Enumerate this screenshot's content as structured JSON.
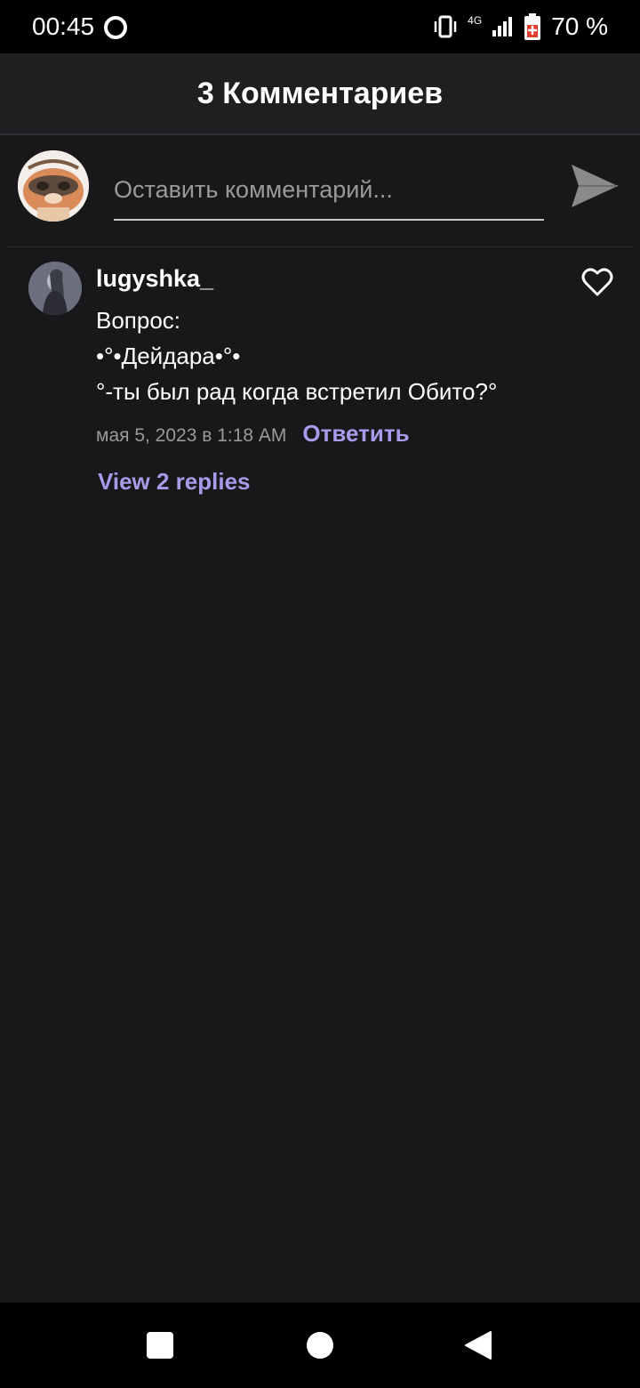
{
  "status_bar": {
    "time": "00:45",
    "battery_percent": "70 %",
    "network": "4G",
    "icons": [
      "opera-icon",
      "vibrate-icon",
      "signal-icon",
      "battery-icon"
    ]
  },
  "header": {
    "title": "3 Комментариев"
  },
  "composer": {
    "placeholder": "Оставить комментарий...",
    "value": "",
    "send_icon": "send-icon"
  },
  "comments": [
    {
      "username": "lugyshka_",
      "lines": [
        "Вопрос:",
        "•°•Дейдара•°•",
        "°-ты был рад когда встретил Обито?°"
      ],
      "date": "мая 5, 2023 в 1:18 AM",
      "reply_label": "Ответить",
      "view_replies_label": "View 2 replies",
      "liked": false
    }
  ],
  "colors": {
    "background": "#18171a",
    "header": "#1f1e21",
    "accent": "#a89ae8",
    "muted_text": "#9a9a9c"
  }
}
